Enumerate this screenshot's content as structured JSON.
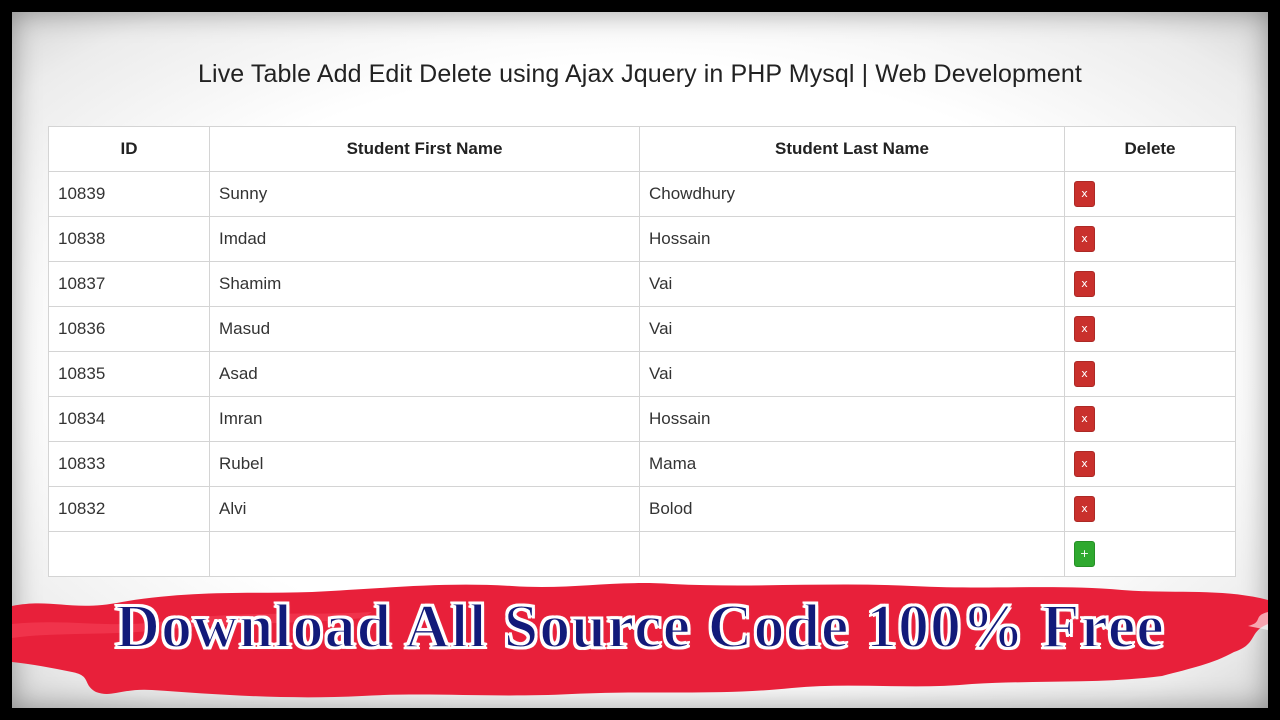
{
  "page": {
    "title": "Live Table Add Edit Delete using Ajax Jquery in PHP Mysql | Web Development"
  },
  "table": {
    "headers": {
      "id": "ID",
      "first_name": "Student First Name",
      "last_name": "Student Last Name",
      "delete": "Delete"
    },
    "rows": [
      {
        "id": "10839",
        "first_name": "Sunny",
        "last_name": "Chowdhury"
      },
      {
        "id": "10838",
        "first_name": "Imdad",
        "last_name": "Hossain"
      },
      {
        "id": "10837",
        "first_name": "Shamim",
        "last_name": "Vai"
      },
      {
        "id": "10836",
        "first_name": "Masud",
        "last_name": "Vai"
      },
      {
        "id": "10835",
        "first_name": "Asad",
        "last_name": "Vai"
      },
      {
        "id": "10834",
        "first_name": "Imran",
        "last_name": "Hossain"
      },
      {
        "id": "10833",
        "first_name": "Rubel",
        "last_name": "Mama"
      },
      {
        "id": "10832",
        "first_name": "Alvi",
        "last_name": "Bolod"
      }
    ],
    "delete_label": "x",
    "add_label": "+"
  },
  "banner": {
    "text": "Download All Source Code 100% Free"
  },
  "colors": {
    "delete_button": "#c9302c",
    "add_button": "#2fa92f",
    "brush_stroke": "#e8203a",
    "banner_text": "#121a7a"
  },
  "icons": {
    "delete": "close-icon",
    "add": "plus-icon"
  }
}
